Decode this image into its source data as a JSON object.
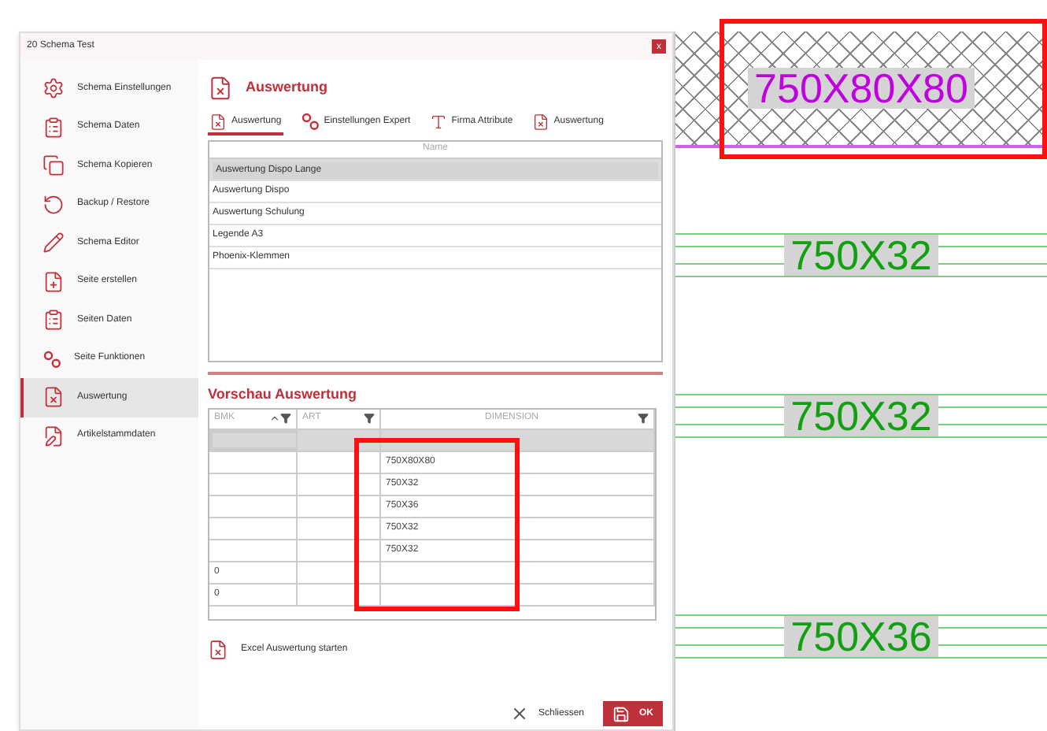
{
  "window": {
    "title": "20 Schema Test",
    "close": "x"
  },
  "sidebar": {
    "items": [
      {
        "label": "Schema Einstellungen",
        "kind": "gear",
        "selected": false
      },
      {
        "label": "Schema Daten",
        "kind": "clipboard",
        "selected": false
      },
      {
        "label": "Schema Kopieren",
        "kind": "copy",
        "selected": false
      },
      {
        "label": "Backup / Restore",
        "kind": "restore",
        "selected": false
      },
      {
        "label": "Schema Editor",
        "kind": "pencil",
        "selected": false
      },
      {
        "label": "Seite erstellen",
        "kind": "filenew",
        "selected": false
      },
      {
        "label": "Seiten Daten",
        "kind": "clipboard",
        "selected": false
      },
      {
        "label": "Seite Funktionen",
        "kind": "circles",
        "selected": false
      },
      {
        "label": "Auswertung",
        "kind": "excel",
        "selected": true
      },
      {
        "label": "Artikelstammdaten",
        "kind": "edit",
        "selected": false
      }
    ]
  },
  "page_title": "Auswertung",
  "tabs": [
    {
      "label": "Auswertung",
      "kind": "excel",
      "selected": true
    },
    {
      "label": "Einstellungen Expert",
      "kind": "circles",
      "selected": false
    },
    {
      "label": "Firma Attribute",
      "kind": "font",
      "selected": false
    },
    {
      "label": "Auswertung",
      "kind": "excel",
      "selected": false
    }
  ],
  "list": {
    "header": "Name",
    "items": [
      {
        "label": "Auswertung Dispo Lange",
        "selected": true
      },
      {
        "label": "Auswertung Dispo",
        "selected": false
      },
      {
        "label": "Auswertung Schulung",
        "selected": false
      },
      {
        "label": "Legende A3",
        "selected": false
      },
      {
        "label": "Phoenix-Klemmen",
        "selected": false
      }
    ]
  },
  "preview": {
    "title": "Vorschau Auswertung",
    "columns": [
      "BMK",
      "ART",
      "DIMENSION"
    ],
    "rows": [
      {
        "cells": [
          "",
          "",
          ""
        ],
        "selected": true
      },
      {
        "cells": [
          "",
          "",
          "750X80X80"
        ],
        "selected": false
      },
      {
        "cells": [
          "",
          "",
          "750X32"
        ],
        "selected": false
      },
      {
        "cells": [
          "",
          "",
          "750X36"
        ],
        "selected": false
      },
      {
        "cells": [
          "",
          "",
          "750X32"
        ],
        "selected": false
      },
      {
        "cells": [
          "",
          "",
          "750X32"
        ],
        "selected": false
      },
      {
        "cells": [
          "0",
          "",
          ""
        ],
        "selected": false
      },
      {
        "cells": [
          "0",
          "",
          ""
        ],
        "selected": false
      }
    ]
  },
  "excel_button": "Excel Auswertung starten",
  "buttons": {
    "close": "Schliessen",
    "ok": "OK"
  },
  "canvas": {
    "labels": [
      {
        "text": "750X80X80",
        "kind": "hatched",
        "color": "#c000e0"
      },
      {
        "text": "750X32",
        "kind": "lined",
        "color": "#10a010"
      },
      {
        "text": "750X32",
        "kind": "lined",
        "color": "#10a010"
      },
      {
        "text": "750X36",
        "kind": "lined",
        "color": "#10a010"
      }
    ]
  }
}
